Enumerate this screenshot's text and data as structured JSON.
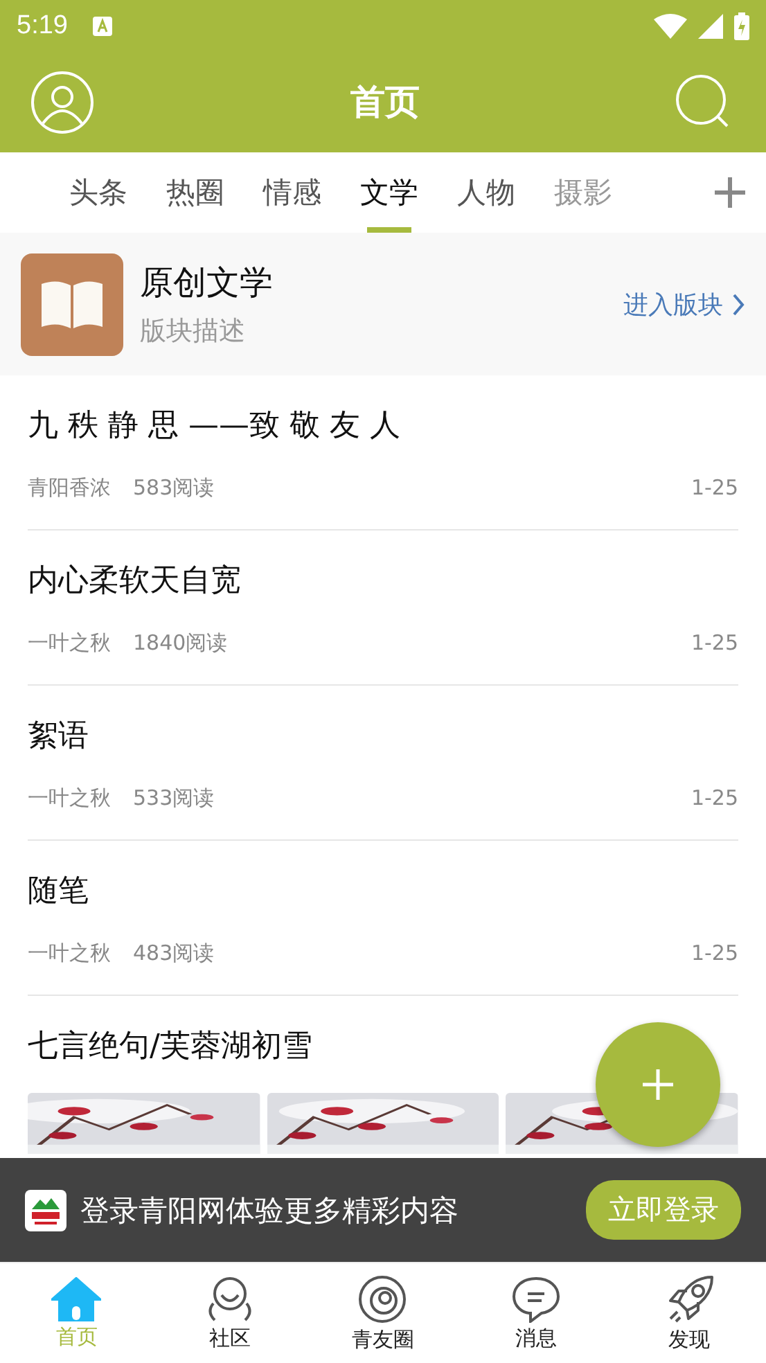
{
  "status_bar": {
    "time": "5:19"
  },
  "header": {
    "title": "首页"
  },
  "tabs": [
    {
      "label": "头条",
      "selected": false
    },
    {
      "label": "热圈",
      "selected": false
    },
    {
      "label": "情感",
      "selected": false
    },
    {
      "label": "文学",
      "selected": true
    },
    {
      "label": "人物",
      "selected": false
    },
    {
      "label": "摄影",
      "selected": false
    }
  ],
  "forum": {
    "name": "原创文学",
    "description": "版块描述",
    "enter": "进入版块"
  },
  "posts": [
    {
      "title": "九 秩 静 思 ——致 敬 友 人",
      "author": "青阳香浓",
      "reads": "583阅读",
      "date": "1-25"
    },
    {
      "title": "内心柔软天自宽",
      "author": "一叶之秋",
      "reads": "1840阅读",
      "date": "1-25"
    },
    {
      "title": "絮语",
      "author": "一叶之秋",
      "reads": "533阅读",
      "date": "1-25"
    },
    {
      "title": "随笔",
      "author": "一叶之秋",
      "reads": "483阅读",
      "date": "1-25"
    },
    {
      "title": "七言绝句/芙蓉湖初雪"
    }
  ],
  "login_banner": {
    "text": "登录青阳网体验更多精彩内容",
    "button": "立即登录"
  },
  "nav": [
    {
      "label": "首页",
      "selected": true
    },
    {
      "label": "社区",
      "selected": false
    },
    {
      "label": "青友圈",
      "selected": false
    },
    {
      "label": "消息",
      "selected": false
    },
    {
      "label": "发现",
      "selected": false
    }
  ]
}
